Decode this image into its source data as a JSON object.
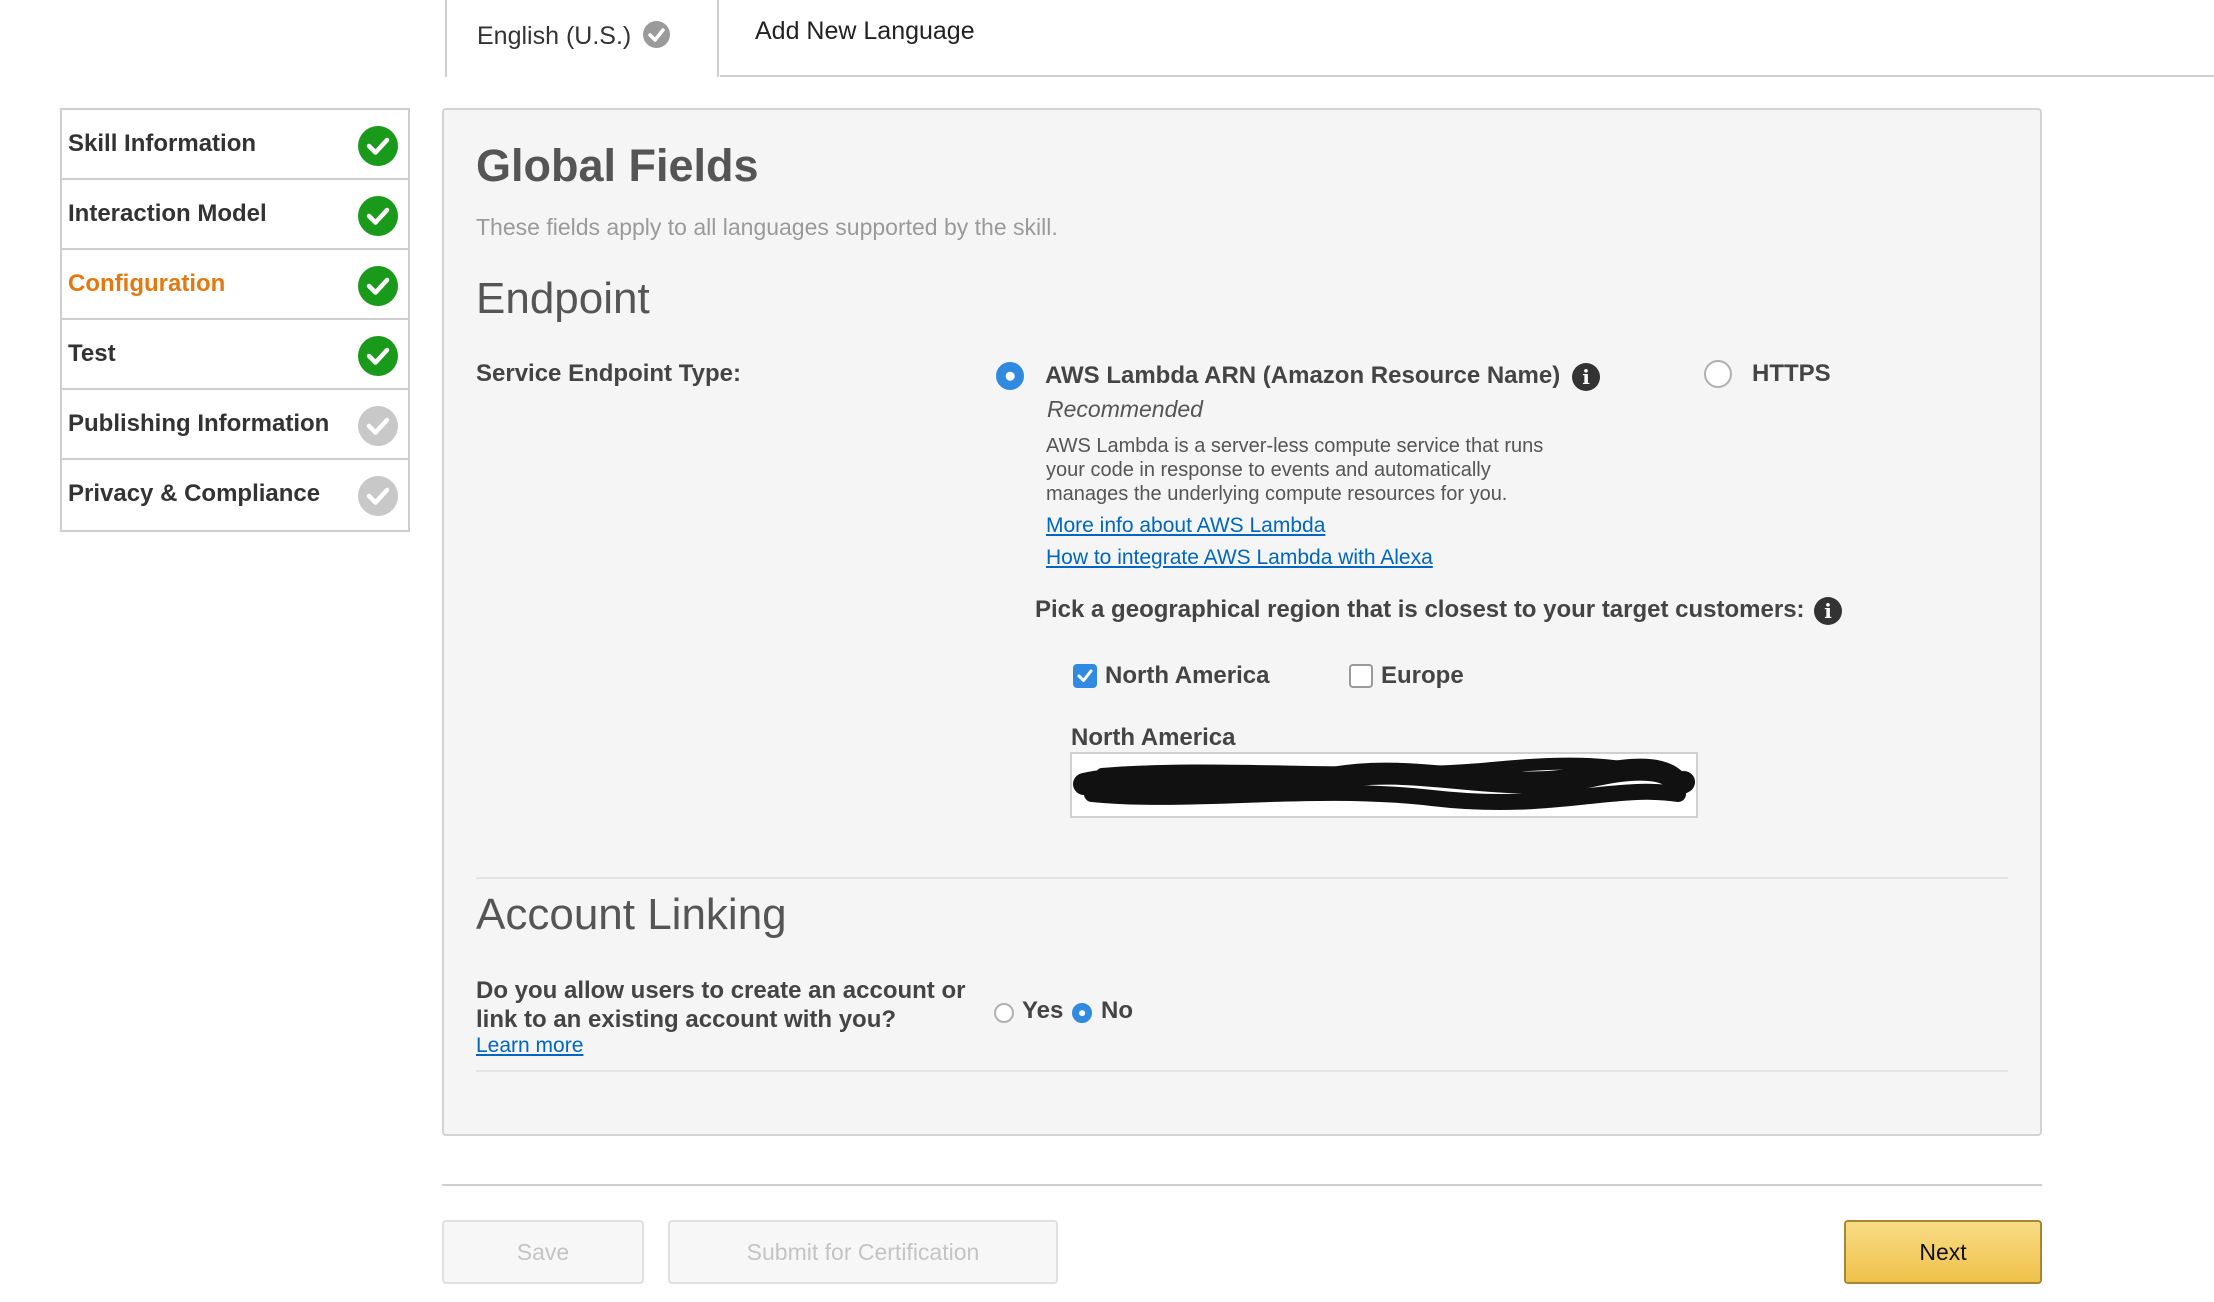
{
  "tabs": {
    "active_label": "English (U.S.)",
    "add_label": "Add New Language"
  },
  "sidebar": {
    "items": [
      {
        "label": "Skill Information",
        "status": "complete"
      },
      {
        "label": "Interaction Model",
        "status": "complete"
      },
      {
        "label": "Configuration",
        "status": "complete",
        "active": true
      },
      {
        "label": "Test",
        "status": "complete"
      },
      {
        "label": "Publishing Information",
        "status": "incomplete"
      },
      {
        "label": "Privacy & Compliance",
        "status": "incomplete"
      }
    ]
  },
  "global": {
    "title": "Global Fields",
    "subtitle": "These fields apply to all languages supported by the skill."
  },
  "endpoint": {
    "title": "Endpoint",
    "type_label": "Service Endpoint Type:",
    "option_lambda": "AWS Lambda ARN (Amazon Resource Name)",
    "recommended": "Recommended",
    "description_lines": [
      "AWS Lambda is a server-less compute service that runs",
      "your code in response to events and automatically",
      "manages the underlying compute resources for you."
    ],
    "link_more_info": "More info about AWS Lambda",
    "link_integrate": "How to integrate AWS Lambda with Alexa",
    "option_https": "HTTPS",
    "selected": "lambda",
    "region_prompt": "Pick a geographical region that is closest to your target customers:",
    "regions": [
      {
        "label": "North America",
        "checked": true
      },
      {
        "label": "Europe",
        "checked": false
      }
    ],
    "na_field_label": "North America",
    "na_field_value": ""
  },
  "account_linking": {
    "title": "Account Linking",
    "question_line1": "Do you allow users to create an account or",
    "question_line2": "link to an existing account with you?",
    "learn_more": "Learn more",
    "yes_label": "Yes",
    "no_label": "No",
    "selected": "no"
  },
  "footer": {
    "save_label": "Save",
    "submit_label": "Submit for Certification",
    "next_label": "Next"
  },
  "colors": {
    "complete": "#1a9a1a",
    "incomplete": "#c8c8c8",
    "active_text": "#e47911",
    "link": "#0066c0",
    "radio_on": "#2f8ae0"
  }
}
